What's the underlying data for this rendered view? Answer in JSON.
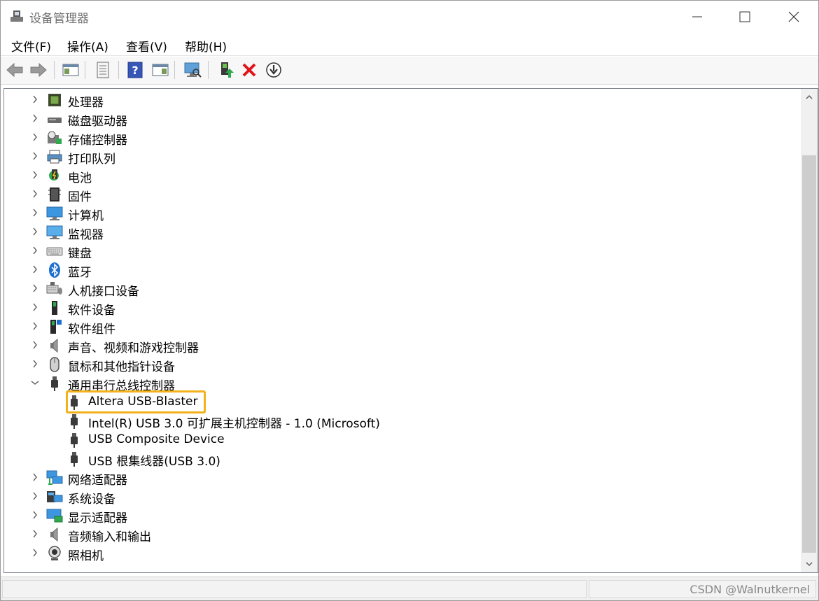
{
  "window": {
    "title": "设备管理器",
    "controls": {
      "minimize_icon": "minimize-icon",
      "maximize_icon": "maximize-icon",
      "close_icon": "close-icon"
    }
  },
  "menu": [
    "文件(F)",
    "操作(A)",
    "查看(V)",
    "帮助(H)"
  ],
  "toolbar": [
    "back-arrow-icon",
    "forward-arrow-icon",
    "show-hide-console-tree-icon",
    "properties-icon",
    "help-icon",
    "action-pane-icon",
    "scan-hardware-icon",
    "update-driver-icon",
    "uninstall-device-icon",
    "disable-device-icon"
  ],
  "tree": {
    "categories_top": [
      {
        "label": "处理器",
        "icon": "processor-icon"
      },
      {
        "label": "磁盘驱动器",
        "icon": "disk-drive-icon"
      },
      {
        "label": "存储控制器",
        "icon": "storage-controller-icon"
      },
      {
        "label": "打印队列",
        "icon": "printer-icon"
      },
      {
        "label": "电池",
        "icon": "battery-icon"
      },
      {
        "label": "固件",
        "icon": "firmware-icon"
      },
      {
        "label": "计算机",
        "icon": "computer-icon"
      },
      {
        "label": "监视器",
        "icon": "monitor-icon"
      },
      {
        "label": "键盘",
        "icon": "keyboard-icon"
      },
      {
        "label": "蓝牙",
        "icon": "bluetooth-icon"
      },
      {
        "label": "人机接口设备",
        "icon": "hid-icon"
      },
      {
        "label": "软件设备",
        "icon": "software-device-icon"
      },
      {
        "label": "软件组件",
        "icon": "software-component-icon"
      },
      {
        "label": "声音、视频和游戏控制器",
        "icon": "speaker-icon"
      },
      {
        "label": "鼠标和其他指针设备",
        "icon": "mouse-icon"
      }
    ],
    "expanded": {
      "label": "通用串行总线控制器",
      "icon": "usb-icon",
      "children": [
        "Altera USB-Blaster",
        "Intel(R) USB 3.0 可扩展主机控制器 - 1.0 (Microsoft)",
        "USB Composite Device",
        "USB 根集线器(USB 3.0)"
      ]
    },
    "categories_bottom": [
      {
        "label": "网络适配器",
        "icon": "network-adapter-icon"
      },
      {
        "label": "系统设备",
        "icon": "system-device-icon"
      },
      {
        "label": "显示适配器",
        "icon": "display-adapter-icon"
      },
      {
        "label": "音频输入和输出",
        "icon": "audio-io-icon"
      },
      {
        "label": "照相机",
        "icon": "camera-icon"
      }
    ],
    "highlighted_child": "Altera USB-Blaster",
    "highlight_color": "#f3b21b"
  },
  "watermark": "CSDN @Walnutkernel"
}
